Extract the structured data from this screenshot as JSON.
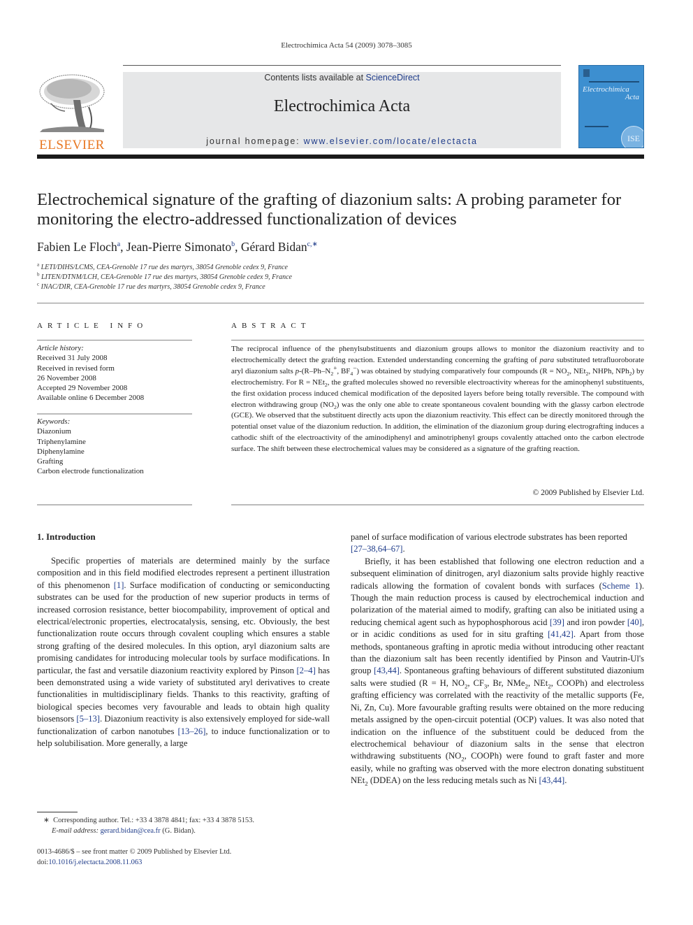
{
  "header": {
    "running_head": "Electrochimica Acta 54 (2009) 3078–3085",
    "contents_prefix": "Contents lists available at ",
    "contents_link": "ScienceDirect",
    "journal_title": "Electrochimica Acta",
    "homepage_prefix": "journal homepage: ",
    "homepage_link": "www.elsevier.com/locate/electacta",
    "publisher_logo_text": "ELSEVIER",
    "cover_title_line1": "Electrochimica",
    "cover_title_line2": "Acta",
    "cover_badge": "ISE"
  },
  "article": {
    "title": "Electrochemical signature of the grafting of diazonium salts: A probing parameter for monitoring the electro-addressed functionalization of devices",
    "authors": [
      {
        "name": "Fabien Le Floch",
        "sup": "a"
      },
      {
        "name": "Jean-Pierre Simonato",
        "sup": "b"
      },
      {
        "name": "Gérard Bidan",
        "sup": "c,∗"
      }
    ],
    "affiliations": [
      {
        "sup": "a",
        "text": "LETI/DIHS/LCMS, CEA-Grenoble 17 rue des martyrs, 38054 Grenoble cedex 9, France"
      },
      {
        "sup": "b",
        "text": "LITEN/DTNM/LCH, CEA-Grenoble 17 rue des martyrs, 38054 Grenoble cedex 9, France"
      },
      {
        "sup": "c",
        "text": "INAC/DIR, CEA-Grenoble 17 rue des martyrs, 38054 Grenoble cedex 9, France"
      }
    ]
  },
  "article_info": {
    "heading": "ARTICLE INFO",
    "history_label": "Article history:",
    "history": [
      "Received 31 July 2008",
      "Received in revised form",
      "26 November 2008",
      "Accepted 29 November 2008",
      "Available online 6 December 2008"
    ],
    "keywords_label": "Keywords:",
    "keywords": [
      "Diazonium",
      "Triphenylamine",
      "Diphenylamine",
      "Grafting",
      "Carbon electrode functionalization"
    ]
  },
  "abstract": {
    "heading": "ABSTRACT",
    "parts": {
      "p1": "The reciprocal influence of the phenylsubstituents and diazonium groups allows to monitor the diazonium reactivity and to electrochemically detect the grafting reaction. Extended understanding concerning the grafting of ",
      "para": "para",
      "p2": " substituted tetrafluoroborate aryl diazonium salts ",
      "p_italic": "p",
      "p3": "-(R–Ph–N",
      "p4": ", BF",
      "p5": ") was obtained by studying comparatively four compounds (R = NO",
      "p6": ", NEt",
      "p7": ", NHPh, NPh",
      "p8": ") by electrochemistry. For R = NEt",
      "p9": ", the grafted molecules showed no reversible electroactivity whereas for the aminophenyl substituents, the first oxidation process induced chemical modification of the deposited layers before being totally reversible. The compound with electron withdrawing group (NO",
      "p10": ") was the only one able to create spontaneous covalent bounding with the glassy carbon electrode (GCE). We observed that the substituent directly acts upon the diazonium reactivity. This effect can be directly monitored through the potential onset value of the diazonium reduction. In addition, the elimination of the diazonium group during electrografting induces a cathodic shift of the electroactivity of the aminodiphenyl and aminotriphenyl groups covalently attached onto the carbon electrode surface. The shift between these electrochemical values may be considered as a signature of the grafting reaction."
    },
    "copyright": "© 2009 Published by Elsevier Ltd."
  },
  "body": {
    "section_heading": "1.  Introduction",
    "left": {
      "t1": "Specific properties of materials are determined mainly by the surface composition and in this field modified electrodes represent a pertinent illustration of this phenomenon ",
      "r1": "[1]",
      "t2": ". Surface modification of conducting or semiconducting substrates can be used for the production of new superior products in terms of increased corrosion resistance, better biocompability, improvement of optical and electrical/electronic properties, electrocatalysis, sensing, etc. Obviously, the best functionalization route occurs through covalent coupling which ensures a stable strong grafting of the desired molecules. In this option, aryl diazonium salts are promising candidates for introducing molecular tools by surface modifications. In particular, the fast and versatile diazonium reactivity explored by Pinson ",
      "r2": "[2–4]",
      "t3": " has been demonstrated using a wide variety of substituted aryl derivatives to create functionalities in multidisciplinary fields. Thanks to this reactivity, grafting of biological species becomes very favourable and leads to obtain high quality biosensors ",
      "r3": "[5–13]",
      "t4": ". Diazonium reactivity is also extensively employed for side-wall functionalization of carbon nanotubes ",
      "r4": "[13–26]",
      "t5": ", to induce functionalization or to help solubilisation. More generally, a large"
    },
    "right": {
      "t1": "panel of surface modification of various electrode substrates has been reported ",
      "r1": "[27–38,64–67]",
      "t2": ".",
      "t3": "Briefly, it has been established that following one electron reduction and a subsequent elimination of dinitrogen, aryl diazonium salts provide highly reactive radicals allowing the formation of covalent bonds with surfaces (",
      "r2": "Scheme 1",
      "t4": "). Though the main reduction process is caused by electrochemical induction and polarization of the material aimed to modify, grafting can also be initiated using a reducing chemical agent such as hypophosphorous acid ",
      "r3": "[39]",
      "t5": " and iron powder ",
      "r4": "[40]",
      "t6": ", or in acidic conditions as used for in situ grafting ",
      "r5": "[41,42]",
      "t7": ". Apart from those methods, spontaneous grafting in aprotic media without introducing other reactant than the diazonium salt has been recently identified by Pinson and Vautrin-Ul's group ",
      "r6": "[43,44]",
      "t8": ". Spontaneous grafting behaviours of different substituted diazonium salts were studied (R = H, NO",
      "t9": ", CF",
      "t10": ", Br, NMe",
      "t11": ", NEt",
      "t12": ", COOPh) and electroless grafting efficiency was correlated with the reactivity of the metallic supports (Fe, Ni, Zn, Cu). More favourable grafting results were obtained on the more reducing metals assigned by the open-circuit potential (OCP) values. It was also noted that indication on the influence of the substituent could be deduced from the electrochemical behaviour of diazonium salts in the sense that electron withdrawing substituents (NO",
      "t13": ", COOPh) were found to graft faster and more easily, while no grafting was observed with the more electron donating substituent NEt",
      "t14": " (DDEA) on the less reducing metals such as Ni ",
      "r7": "[43,44]",
      "t15": "."
    }
  },
  "footnote": {
    "marker": "∗",
    "text": "Corresponding author. Tel.: +33 4 3878 4841; fax: +33 4 3878 5153.",
    "email_label": "E-mail address:",
    "email": "gerard.bidan@cea.fr",
    "email_suffix": " (G. Bidan)."
  },
  "front_matter": {
    "line1": "0013-4686/$ – see front matter © 2009 Published by Elsevier Ltd.",
    "doi_prefix": "doi:",
    "doi": "10.1016/j.electacta.2008.11.063"
  },
  "sub": {
    "two": "2",
    "three": "3",
    "four": "4",
    "plus": "+",
    "minus": "−"
  },
  "colors": {
    "link": "#1f3c8a",
    "elsevier_orange": "#e87722",
    "banner_grey": "#e6e7e8",
    "cover_blue": "#3d8fd0"
  }
}
